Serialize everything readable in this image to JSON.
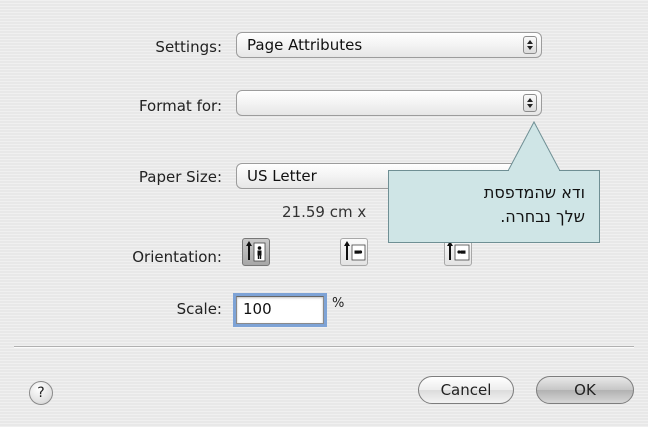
{
  "settings": {
    "label": "Settings:",
    "value": "Page Attributes"
  },
  "format": {
    "label": "Format for:",
    "value": ""
  },
  "paper": {
    "label": "Paper Size:",
    "value": "US Letter",
    "dimensions": "21.59 cm x"
  },
  "orientation": {
    "label": "Orientation:",
    "selected": "portrait"
  },
  "scale": {
    "label": "Scale:",
    "value": "100",
    "unit": "%"
  },
  "callout": {
    "line1": "ודא שהמדפסת",
    "line2": "שלך נבחרה."
  },
  "buttons": {
    "help": "?",
    "cancel": "Cancel",
    "ok": "OK"
  },
  "colors": {
    "callout_bg": "#cfe5e6",
    "focus_ring": "#7ea3d6"
  }
}
